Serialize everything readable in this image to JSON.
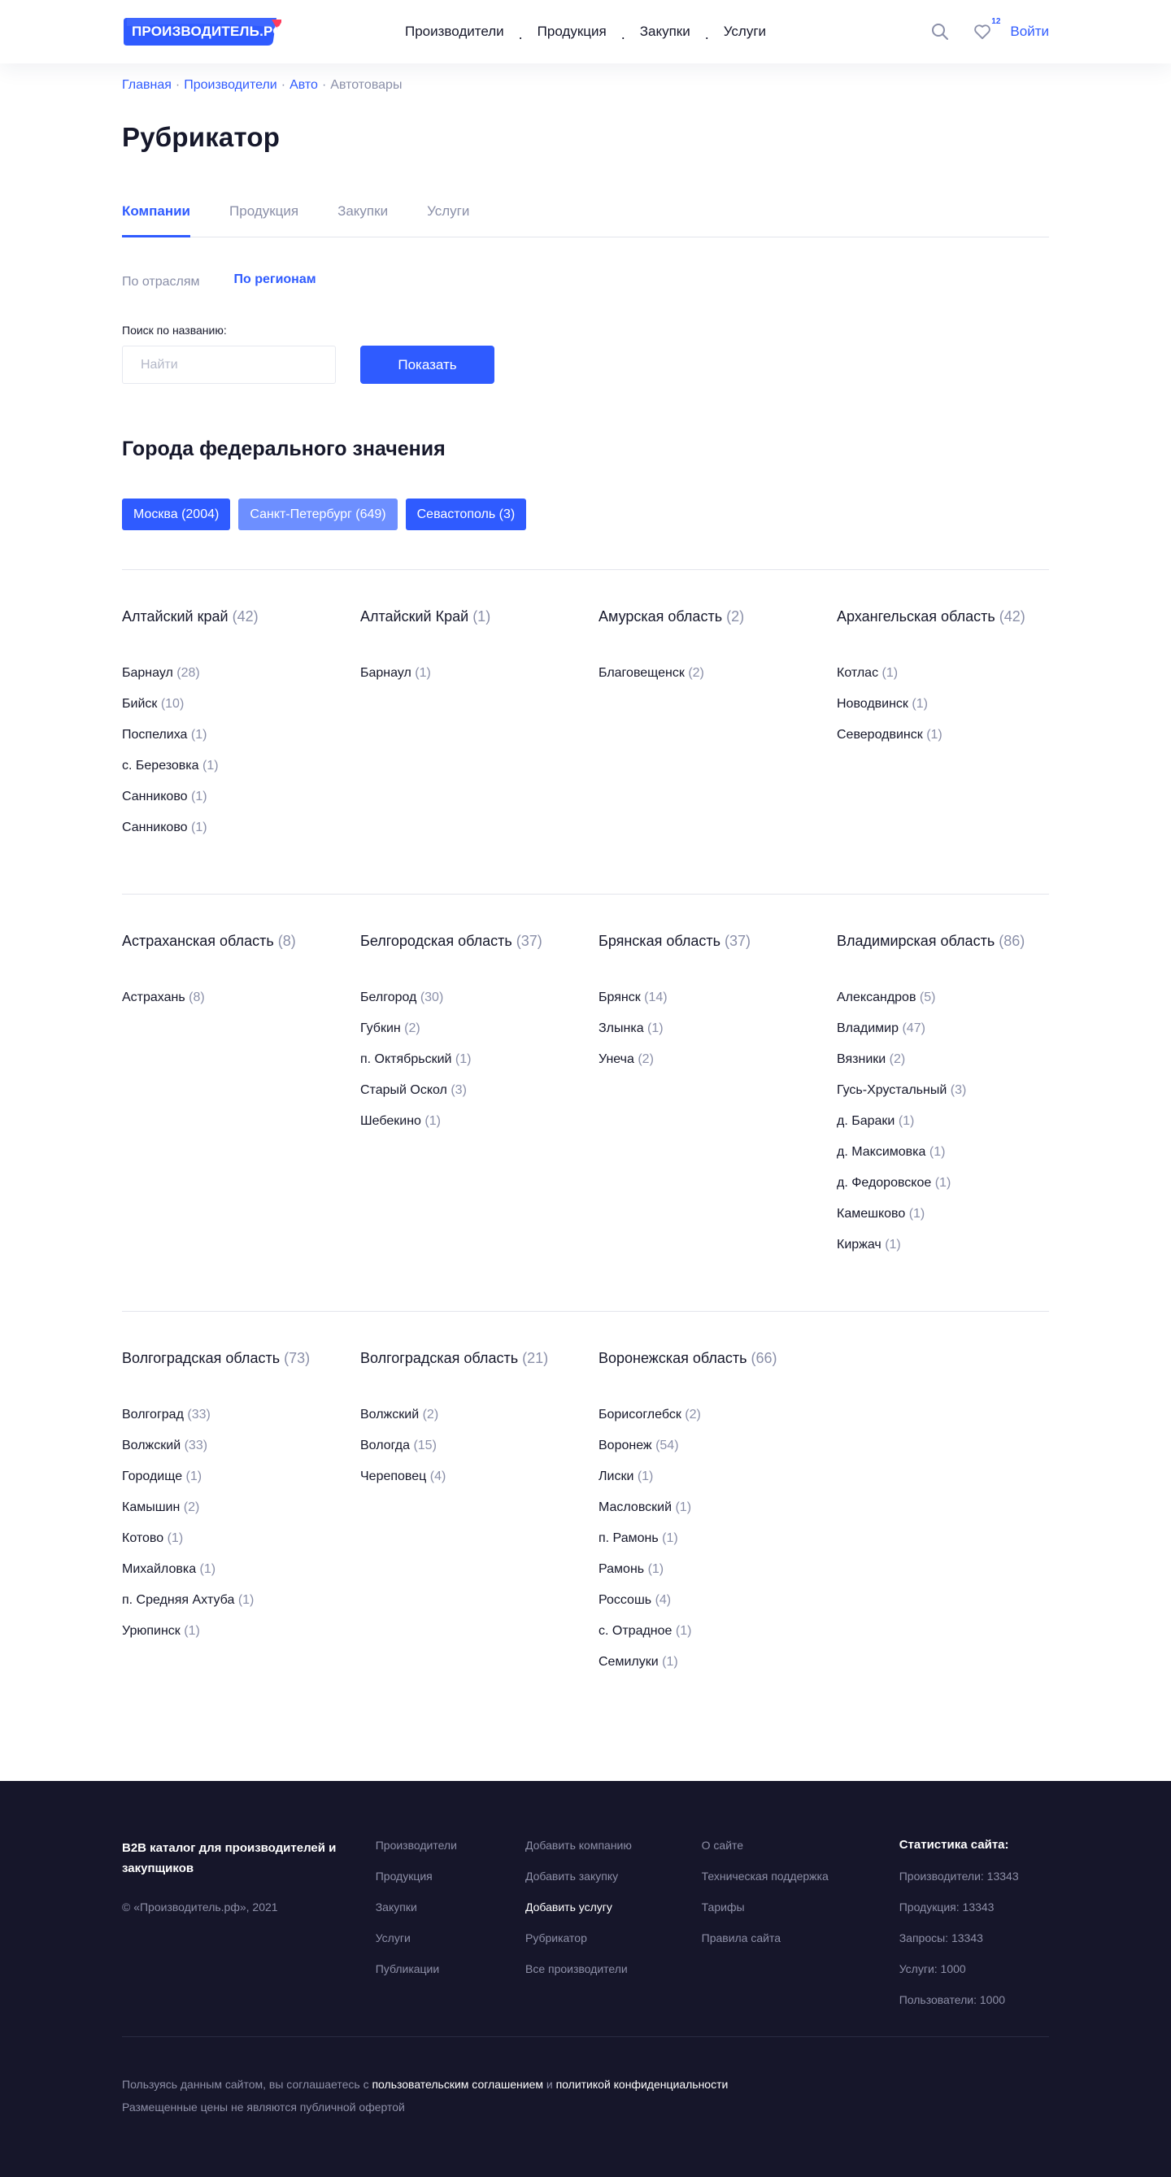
{
  "header": {
    "logo_text": "ПРОИЗВОДИТЕЛЬ.РФ",
    "nav": [
      "Производители",
      "Продукция",
      "Закупки",
      "Услуги"
    ],
    "favorites_count": "12",
    "login": "Войти"
  },
  "breadcrumb": {
    "items": [
      "Главная",
      "Производители",
      "Авто"
    ],
    "current": "Автотовары"
  },
  "page_title": "Рубрикатор",
  "tabs": [
    "Компании",
    "Продукция",
    "Закупки",
    "Услуги"
  ],
  "subtabs": [
    "По отраслям",
    "По регионам"
  ],
  "search": {
    "label": "Поиск по названию:",
    "placeholder": "Найти",
    "button": "Показать"
  },
  "federal": {
    "title": "Города федерального значения",
    "chips": [
      "Москва (2004)",
      "Санкт-Петербург (649)",
      "Севастополь (3)"
    ]
  },
  "region_groups": [
    [
      {
        "name": "Алтайский край",
        "count": "(42)",
        "cities": [
          {
            "name": "Барнаул",
            "count": "(28)"
          },
          {
            "name": "Бийск",
            "count": "(10)"
          },
          {
            "name": "Поспелиха",
            "count": "(1)"
          },
          {
            "name": "с. Березовка",
            "count": "(1)"
          },
          {
            "name": "Санниково",
            "count": "(1)"
          },
          {
            "name": "Санниково",
            "count": "(1)"
          }
        ]
      },
      {
        "name": "Алтайский Край",
        "count": "(1)",
        "cities": [
          {
            "name": "Барнаул",
            "count": "(1)"
          }
        ]
      },
      {
        "name": "Амурская область",
        "count": "(2)",
        "cities": [
          {
            "name": "Благовещенск",
            "count": "(2)"
          }
        ]
      },
      {
        "name": "Архангельская область",
        "count": "(42)",
        "cities": [
          {
            "name": "Котлас",
            "count": "(1)"
          },
          {
            "name": "Новодвинск",
            "count": "(1)"
          },
          {
            "name": "Северодвинск",
            "count": "(1)"
          }
        ]
      }
    ],
    [
      {
        "name": "Астраханская область",
        "count": "(8)",
        "cities": [
          {
            "name": "Астрахань",
            "count": "(8)"
          }
        ]
      },
      {
        "name": "Белгородская область",
        "count": "(37)",
        "cities": [
          {
            "name": "Белгород",
            "count": "(30)"
          },
          {
            "name": "Губкин",
            "count": "(2)"
          },
          {
            "name": "п. Октябрьский",
            "count": "(1)"
          },
          {
            "name": "Старый Оскол",
            "count": "(3)"
          },
          {
            "name": "Шебекино",
            "count": "(1)"
          }
        ]
      },
      {
        "name": "Брянская область",
        "count": "(37)",
        "cities": [
          {
            "name": "Брянск",
            "count": "(14)"
          },
          {
            "name": "Злынка",
            "count": "(1)"
          },
          {
            "name": "Унеча",
            "count": "(2)"
          }
        ]
      },
      {
        "name": "Владимирская область",
        "count": "(86)",
        "cities": [
          {
            "name": "Александров",
            "count": "(5)"
          },
          {
            "name": "Владимир",
            "count": "(47)"
          },
          {
            "name": "Вязники",
            "count": "(2)"
          },
          {
            "name": "Гусь-Хрустальный",
            "count": "(3)"
          },
          {
            "name": "д. Бараки",
            "count": "(1)"
          },
          {
            "name": "д. Максимовка",
            "count": "(1)"
          },
          {
            "name": "д. Федоровское",
            "count": "(1)"
          },
          {
            "name": "Камешково",
            "count": "(1)"
          },
          {
            "name": "Киржач",
            "count": "(1)"
          }
        ]
      }
    ],
    [
      {
        "name": "Волгоградская область",
        "count": "(73)",
        "cities": [
          {
            "name": "Волгоград",
            "count": "(33)"
          },
          {
            "name": "Волжский",
            "count": "(33)"
          },
          {
            "name": "Городище",
            "count": "(1)"
          },
          {
            "name": "Камышин",
            "count": "(2)"
          },
          {
            "name": "Котово",
            "count": "(1)"
          },
          {
            "name": "Михайловка",
            "count": "(1)"
          },
          {
            "name": "п. Средняя Ахтуба",
            "count": "(1)"
          },
          {
            "name": "Урюпинск",
            "count": "(1)"
          }
        ]
      },
      {
        "name": "Волгоградская область",
        "count": "(21)",
        "cities": [
          {
            "name": "Волжский",
            "count": "(2)"
          },
          {
            "name": "Вологда",
            "count": "(15)"
          },
          {
            "name": "Череповец",
            "count": "(4)"
          }
        ]
      },
      {
        "name": "Воронежская область",
        "count": "(66)",
        "cities": [
          {
            "name": "Борисоглебск",
            "count": "(2)"
          },
          {
            "name": "Воронеж",
            "count": "(54)"
          },
          {
            "name": "Лиски",
            "count": "(1)"
          },
          {
            "name": "Масловский",
            "count": "(1)"
          },
          {
            "name": "п. Рамонь",
            "count": "(1)"
          },
          {
            "name": "Рамонь",
            "count": "(1)"
          },
          {
            "name": "Россошь",
            "count": "(4)"
          },
          {
            "name": "с. Отрадное",
            "count": "(1)"
          },
          {
            "name": "Семилуки",
            "count": "(1)"
          }
        ]
      }
    ]
  ],
  "footer": {
    "about_title": "B2B каталог для производителей и закупщиков",
    "copyright": "© «Производитель.рф», 2021",
    "col1": [
      "Производители",
      "Продукция",
      "Закупки",
      "Услуги",
      "Публикации"
    ],
    "col2": [
      "Добавить компанию",
      "Добавить закупку",
      "Добавить услугу",
      "Рубрикатор",
      "Все производители"
    ],
    "col3": [
      "О сайте",
      "Техническая поддержка",
      "Тарифы",
      "Правила сайта"
    ],
    "stats_title": "Статистика сайта:",
    "stats": [
      "Производители: 13343",
      "Продукция: 13343",
      "Запросы: 13343",
      "Услуги: 1000",
      "Пользователи: 1000"
    ],
    "agreement_prefix": "Пользуясь данным сайтом, вы соглашаетесь с",
    "agreement_link": "пользовательским соглашением",
    "agreement_and": "и",
    "privacy_link": "политикой конфиденциальности",
    "price_note": "Размещенные цены не являются публичной офертой"
  },
  "colors": {
    "accent": "#2f5bff",
    "chip_light": "#6d8fff",
    "footer_bg": "#16162a",
    "muted": "#8a8fa8"
  }
}
